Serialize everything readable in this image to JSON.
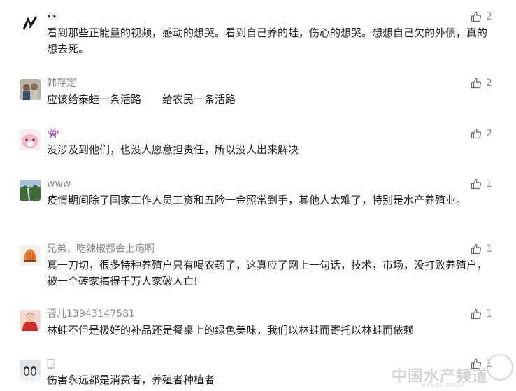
{
  "comments": [
    {
      "name": "👀",
      "text": "看到那些正能量的视频，感动的想哭。看到自己养的蛙，伤心的想哭。想想自己欠的外债，真的想去死。",
      "likes": "2"
    },
    {
      "name": "韩存定",
      "text": "应该给泰蛙一条活路　　给农民一条活路",
      "likes": "2"
    },
    {
      "name": "👾",
      "text": "没涉及到他们，也没人愿意担责任，所以没人出来解决",
      "likes": "2"
    },
    {
      "name": "www",
      "text": "疫情期间除了国家工作人员工资和五险一金照常到手，其他人太难了，特别是水产养殖业。",
      "likes": "1"
    },
    {
      "name": "兄弟，吃辣椒都会上瘾啊",
      "text": "真一刀切，很多特种养殖户只有喝农药了，这真应了网上一句话，技术，市场，没打败养殖户，被一个砖家搞得千万人家破人亡!",
      "likes": "1"
    },
    {
      "name": "蓉儿13943147581",
      "text": "林蛙不但是极好的补品还是餐桌上的绿色美味，我们以林蛙而寄托以林蛙而依赖",
      "likes": "1"
    },
    {
      "name": "🀆",
      "text": "伤害永远都是消费者，养殖者种植者",
      "likes": "1"
    }
  ],
  "watermark": {
    "title": "中国水产频道",
    "url": "www.fishfirst.cn"
  },
  "colors": {
    "meta": "#8c8c8c",
    "text": "#222222",
    "background": "#ffffff"
  }
}
